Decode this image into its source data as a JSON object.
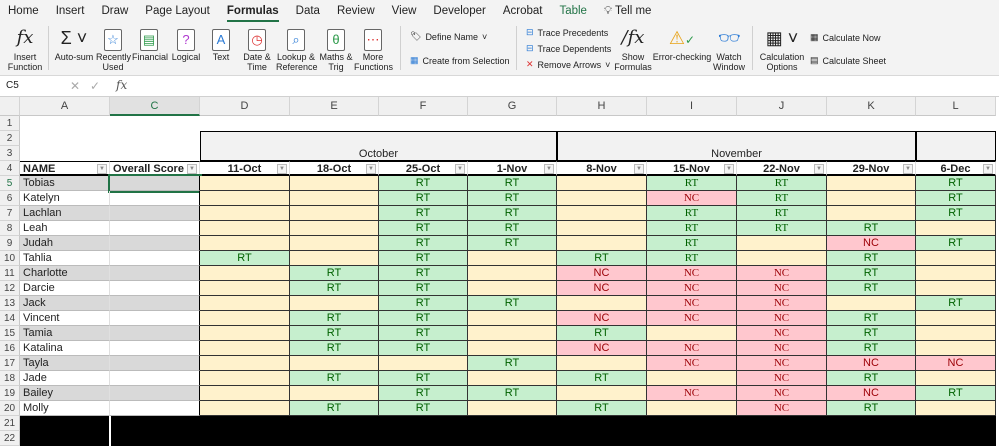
{
  "tabs": [
    "Home",
    "Insert",
    "Draw",
    "Page Layout",
    "Formulas",
    "Data",
    "Review",
    "View",
    "Developer",
    "Acrobat",
    "Table",
    "Tell me"
  ],
  "ribbon": {
    "insert_function": "Insert Function",
    "autosum": "Auto-sum",
    "recently_used": "Recently Used",
    "financial": "Financial",
    "logical": "Logical",
    "text": "Text",
    "date_time": "Date & Time",
    "lookup": "Lookup & Reference",
    "maths": "Maths & Trig",
    "more": "More Functions",
    "define_name": "Define Name",
    "create_from_selection": "Create from Selection",
    "trace_precedents": "Trace Precedents",
    "trace_dependents": "Trace Dependents",
    "remove_arrows": "Remove Arrows",
    "show_formulas": "Show Formulas",
    "error_checking": "Error-checking",
    "watch_window": "Watch Window",
    "calc_options": "Calculation Options",
    "calc_now": "Calculate Now",
    "calc_sheet": "Calculate Sheet"
  },
  "formula_bar": {
    "name_box": "C5",
    "fx": "fx",
    "value": ""
  },
  "columns": [
    "A",
    "C",
    "D",
    "E",
    "F",
    "G",
    "H",
    "I",
    "J",
    "K",
    "L"
  ],
  "rows": [
    "1",
    "2",
    "3",
    "4",
    "5",
    "6",
    "7",
    "8",
    "9",
    "10",
    "11",
    "12",
    "13",
    "14",
    "15",
    "16",
    "17",
    "18",
    "19",
    "20",
    "21",
    "22"
  ],
  "months": {
    "october": "October",
    "november": "November"
  },
  "headers": {
    "name": "NAME",
    "score": "Overall Score",
    "dates": [
      "11-Oct",
      "18-Oct",
      "25-Oct",
      "1-Nov",
      "8-Nov",
      "15-Nov",
      "22-Nov",
      "29-Nov",
      "6-Dec"
    ]
  },
  "students": [
    {
      "name": "Tobias",
      "score": "",
      "marks": [
        "",
        "",
        "RT",
        "RT",
        "",
        "RT",
        "RT",
        "",
        "RT"
      ]
    },
    {
      "name": "Katelyn",
      "score": "",
      "marks": [
        "",
        "",
        "RT",
        "RT",
        "",
        "NC",
        "RT",
        "",
        "RT"
      ]
    },
    {
      "name": "Lachlan",
      "score": "",
      "marks": [
        "",
        "",
        "RT",
        "RT",
        "",
        "RT",
        "RT",
        "",
        "RT"
      ]
    },
    {
      "name": "Leah",
      "score": "",
      "marks": [
        "",
        "",
        "RT",
        "RT",
        "",
        "RT",
        "RT",
        "RT",
        ""
      ]
    },
    {
      "name": "Judah",
      "score": "",
      "marks": [
        "",
        "",
        "RT",
        "RT",
        "",
        "RT",
        "",
        "NC",
        "RT"
      ]
    },
    {
      "name": "Tahlia",
      "score": "",
      "marks": [
        "RT",
        "",
        "RT",
        "",
        "RT",
        "RT",
        "",
        "RT",
        ""
      ]
    },
    {
      "name": "Charlotte",
      "score": "",
      "marks": [
        "",
        "RT",
        "RT",
        "",
        "NC",
        "NC",
        "NC",
        "RT",
        ""
      ]
    },
    {
      "name": "Darcie",
      "score": "",
      "marks": [
        "",
        "RT",
        "RT",
        "",
        "NC",
        "NC",
        "NC",
        "RT",
        ""
      ]
    },
    {
      "name": "Jack",
      "score": "",
      "marks": [
        "",
        "",
        "RT",
        "RT",
        "",
        "NC",
        "NC",
        "",
        "RT"
      ]
    },
    {
      "name": "Vincent",
      "score": "",
      "marks": [
        "",
        "RT",
        "RT",
        "",
        "NC",
        "NC",
        "NC",
        "RT",
        ""
      ]
    },
    {
      "name": "Tamia",
      "score": "",
      "marks": [
        "",
        "RT",
        "RT",
        "",
        "RT",
        "",
        "NC",
        "RT",
        ""
      ]
    },
    {
      "name": "Katalina",
      "score": "",
      "marks": [
        "",
        "RT",
        "RT",
        "",
        "NC",
        "NC",
        "NC",
        "RT",
        ""
      ]
    },
    {
      "name": "Tayla",
      "score": "",
      "marks": [
        "",
        "",
        "",
        "RT",
        "",
        "NC",
        "NC",
        "NC",
        "NC"
      ]
    },
    {
      "name": "Jade",
      "score": "",
      "marks": [
        "",
        "RT",
        "RT",
        "",
        "RT",
        "",
        "NC",
        "RT",
        ""
      ]
    },
    {
      "name": "Bailey",
      "score": "",
      "marks": [
        "",
        "",
        "RT",
        "RT",
        "",
        "NC",
        "NC",
        "NC",
        "RT"
      ]
    },
    {
      "name": "Molly",
      "score": "",
      "marks": [
        "",
        "RT",
        "RT",
        "",
        "RT",
        "",
        "NC",
        "RT",
        ""
      ]
    }
  ],
  "colors": {
    "rt_bg": "#c6efce",
    "rt_text": "#006100",
    "nc_bg": "#ffc7ce",
    "nc_text": "#9c0006",
    "empty_bg": "#fff2cc",
    "accent": "#217346"
  }
}
